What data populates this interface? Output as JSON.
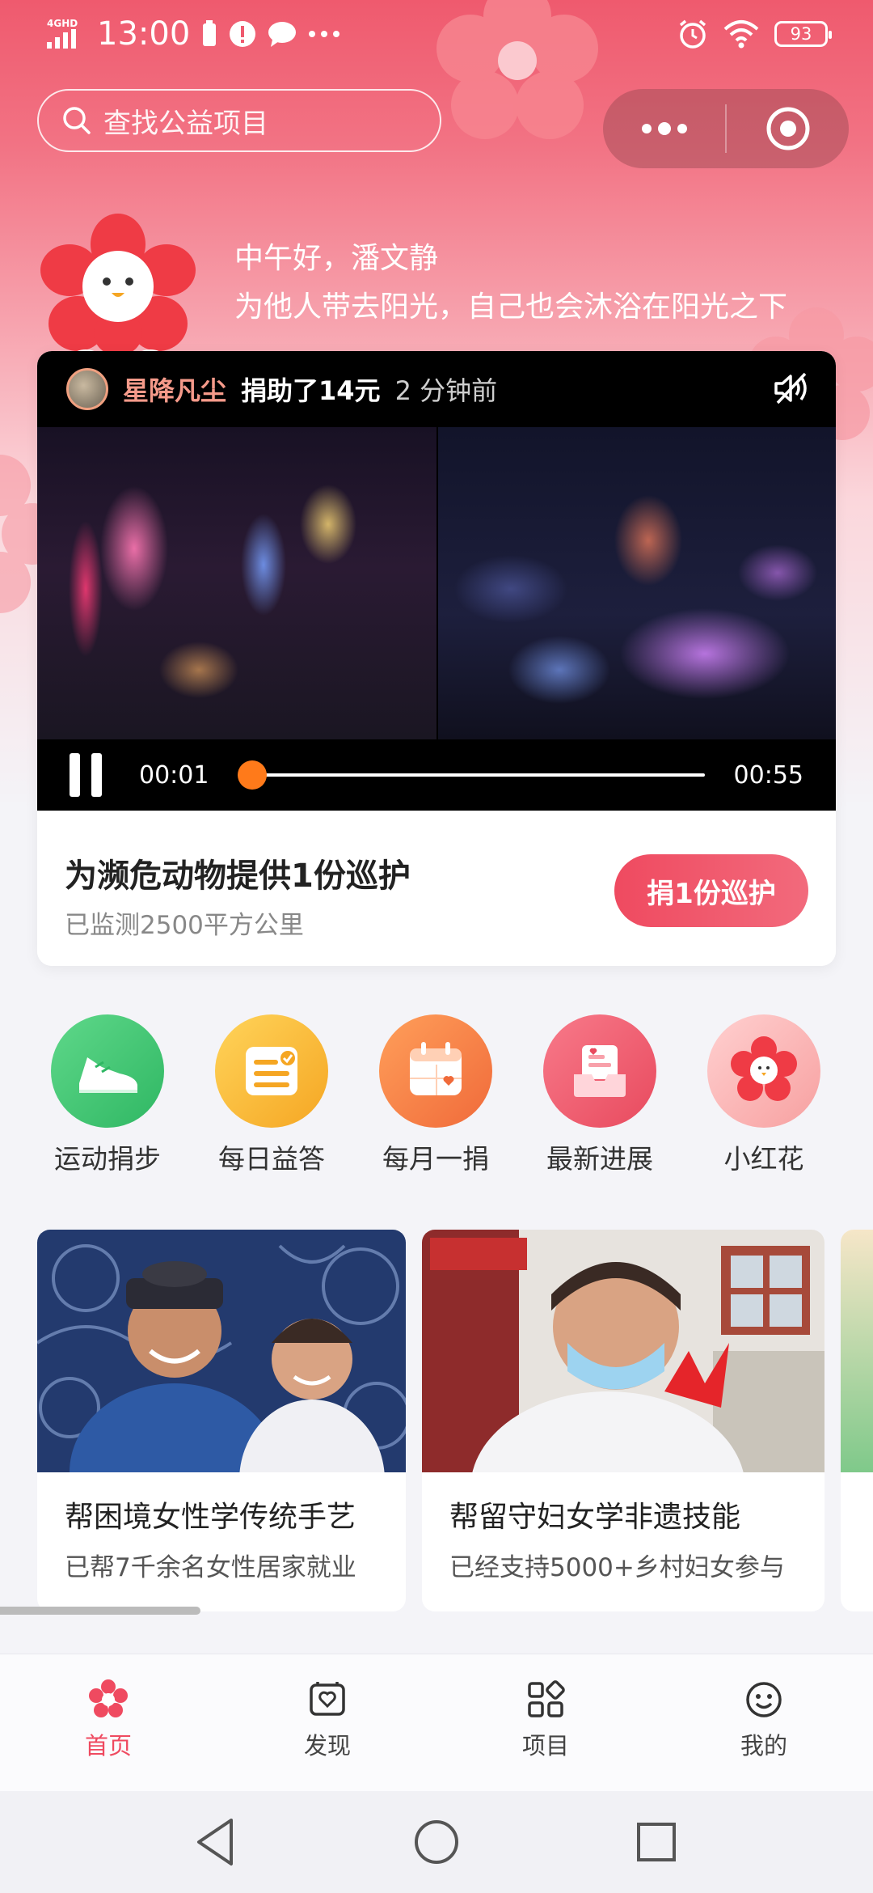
{
  "status_bar": {
    "network": "4GHD",
    "time": "13:00",
    "battery": "93"
  },
  "search": {
    "placeholder": "查找公益项目"
  },
  "greeting": {
    "line1": "中午好，潘文静",
    "line2": "为他人带去阳光，自己也会沐浴在阳光之下"
  },
  "video": {
    "donor_name": "星降凡尘",
    "donor_action": "捐助了14元",
    "donor_time": "2 分钟前",
    "current_time": "00:01",
    "duration": "00:55",
    "progress": 0.03
  },
  "featured": {
    "title": "为濒危动物提供1份巡护",
    "subtitle": "已监测2500平方公里",
    "button": "捐1份巡护"
  },
  "shortcuts": [
    {
      "label": "运动捐步",
      "icon": "sneaker-icon",
      "color": "#3ec46d"
    },
    {
      "label": "每日益答",
      "icon": "quiz-card-icon",
      "color": "#f7b731"
    },
    {
      "label": "每月一捐",
      "icon": "calendar-icon",
      "color": "#f5803e"
    },
    {
      "label": "最新进展",
      "icon": "inbox-tray-icon",
      "color": "#ef5a6e"
    },
    {
      "label": "小红花",
      "icon": "red-flower-icon",
      "color": "#f7a6a6"
    }
  ],
  "projects": [
    {
      "title": "帮困境女性学传统手艺",
      "subtitle": "已帮7千余名女性居家就业"
    },
    {
      "title": "帮留守妇女学非遗技能",
      "subtitle": "已经支持5000+乡村妇女参与"
    }
  ],
  "tabs": [
    {
      "label": "首页",
      "icon": "flower-home-icon",
      "active": true
    },
    {
      "label": "发现",
      "icon": "discover-icon",
      "active": false
    },
    {
      "label": "项目",
      "icon": "grid-projects-icon",
      "active": false
    },
    {
      "label": "我的",
      "icon": "smiley-icon",
      "active": false
    }
  ],
  "colors": {
    "accent": "#ef4a60",
    "progress": "#ff7a1a"
  }
}
